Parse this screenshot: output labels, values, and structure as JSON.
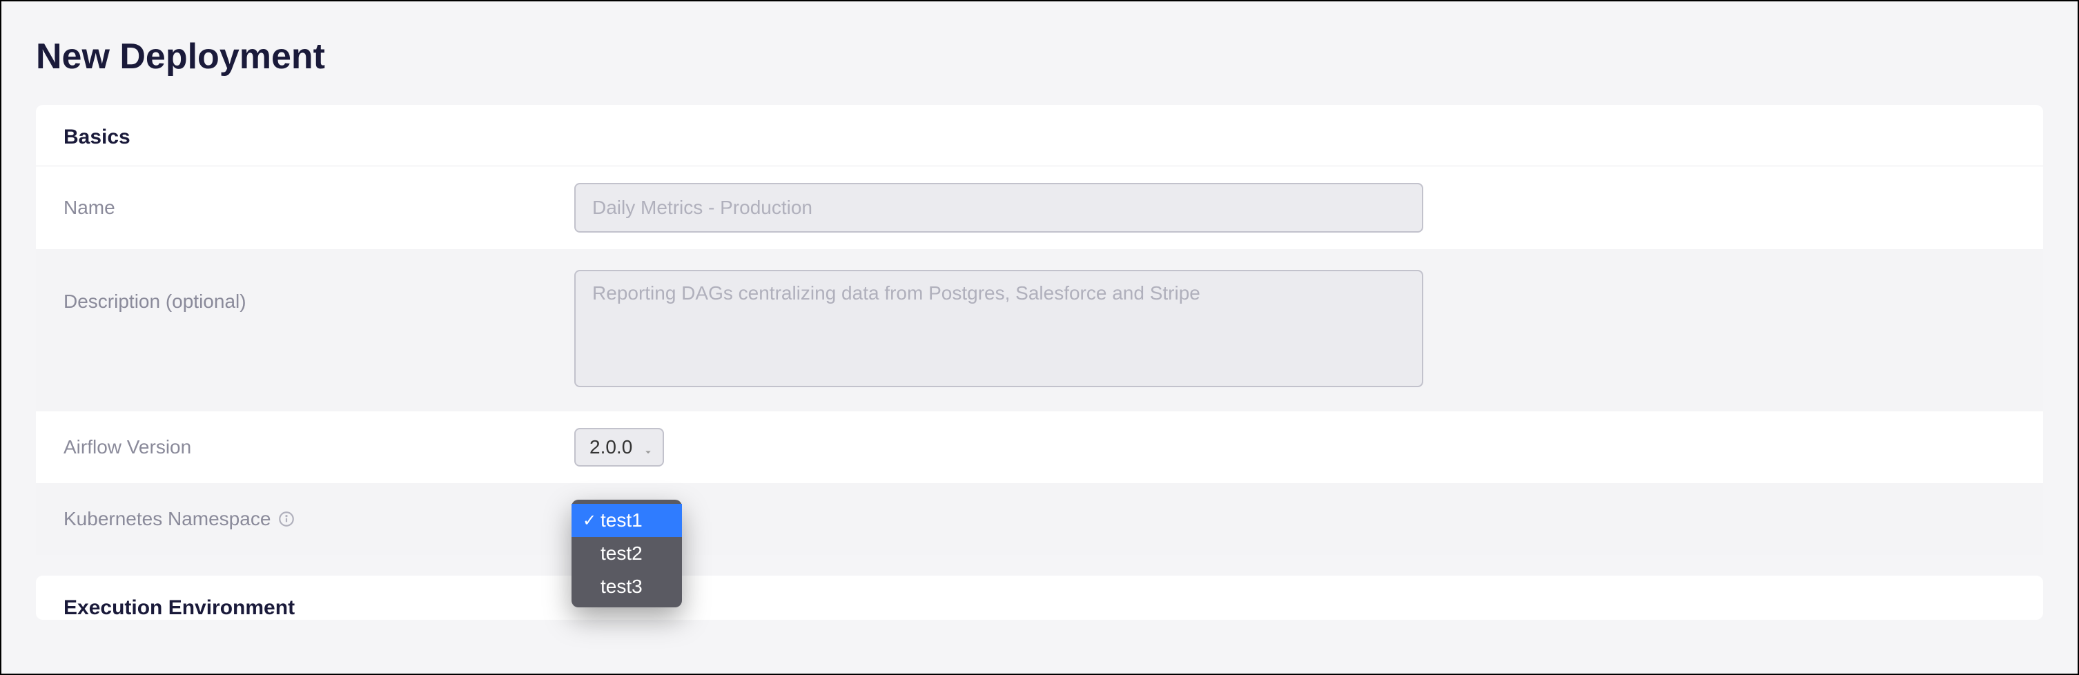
{
  "page": {
    "title": "New Deployment"
  },
  "sections": {
    "basics": {
      "heading": "Basics",
      "fields": {
        "name": {
          "label": "Name",
          "placeholder": "Daily Metrics - Production",
          "value": ""
        },
        "description": {
          "label": "Description (optional)",
          "placeholder": "Reporting DAGs centralizing data from Postgres, Salesforce and Stripe",
          "value": ""
        },
        "airflow_version": {
          "label": "Airflow Version",
          "selected": "2.0.0"
        },
        "kubernetes_namespace": {
          "label": "Kubernetes Namespace",
          "selected": "test1",
          "options": [
            "test1",
            "test2",
            "test3"
          ]
        }
      }
    },
    "execution": {
      "heading": "Execution Environment"
    }
  }
}
